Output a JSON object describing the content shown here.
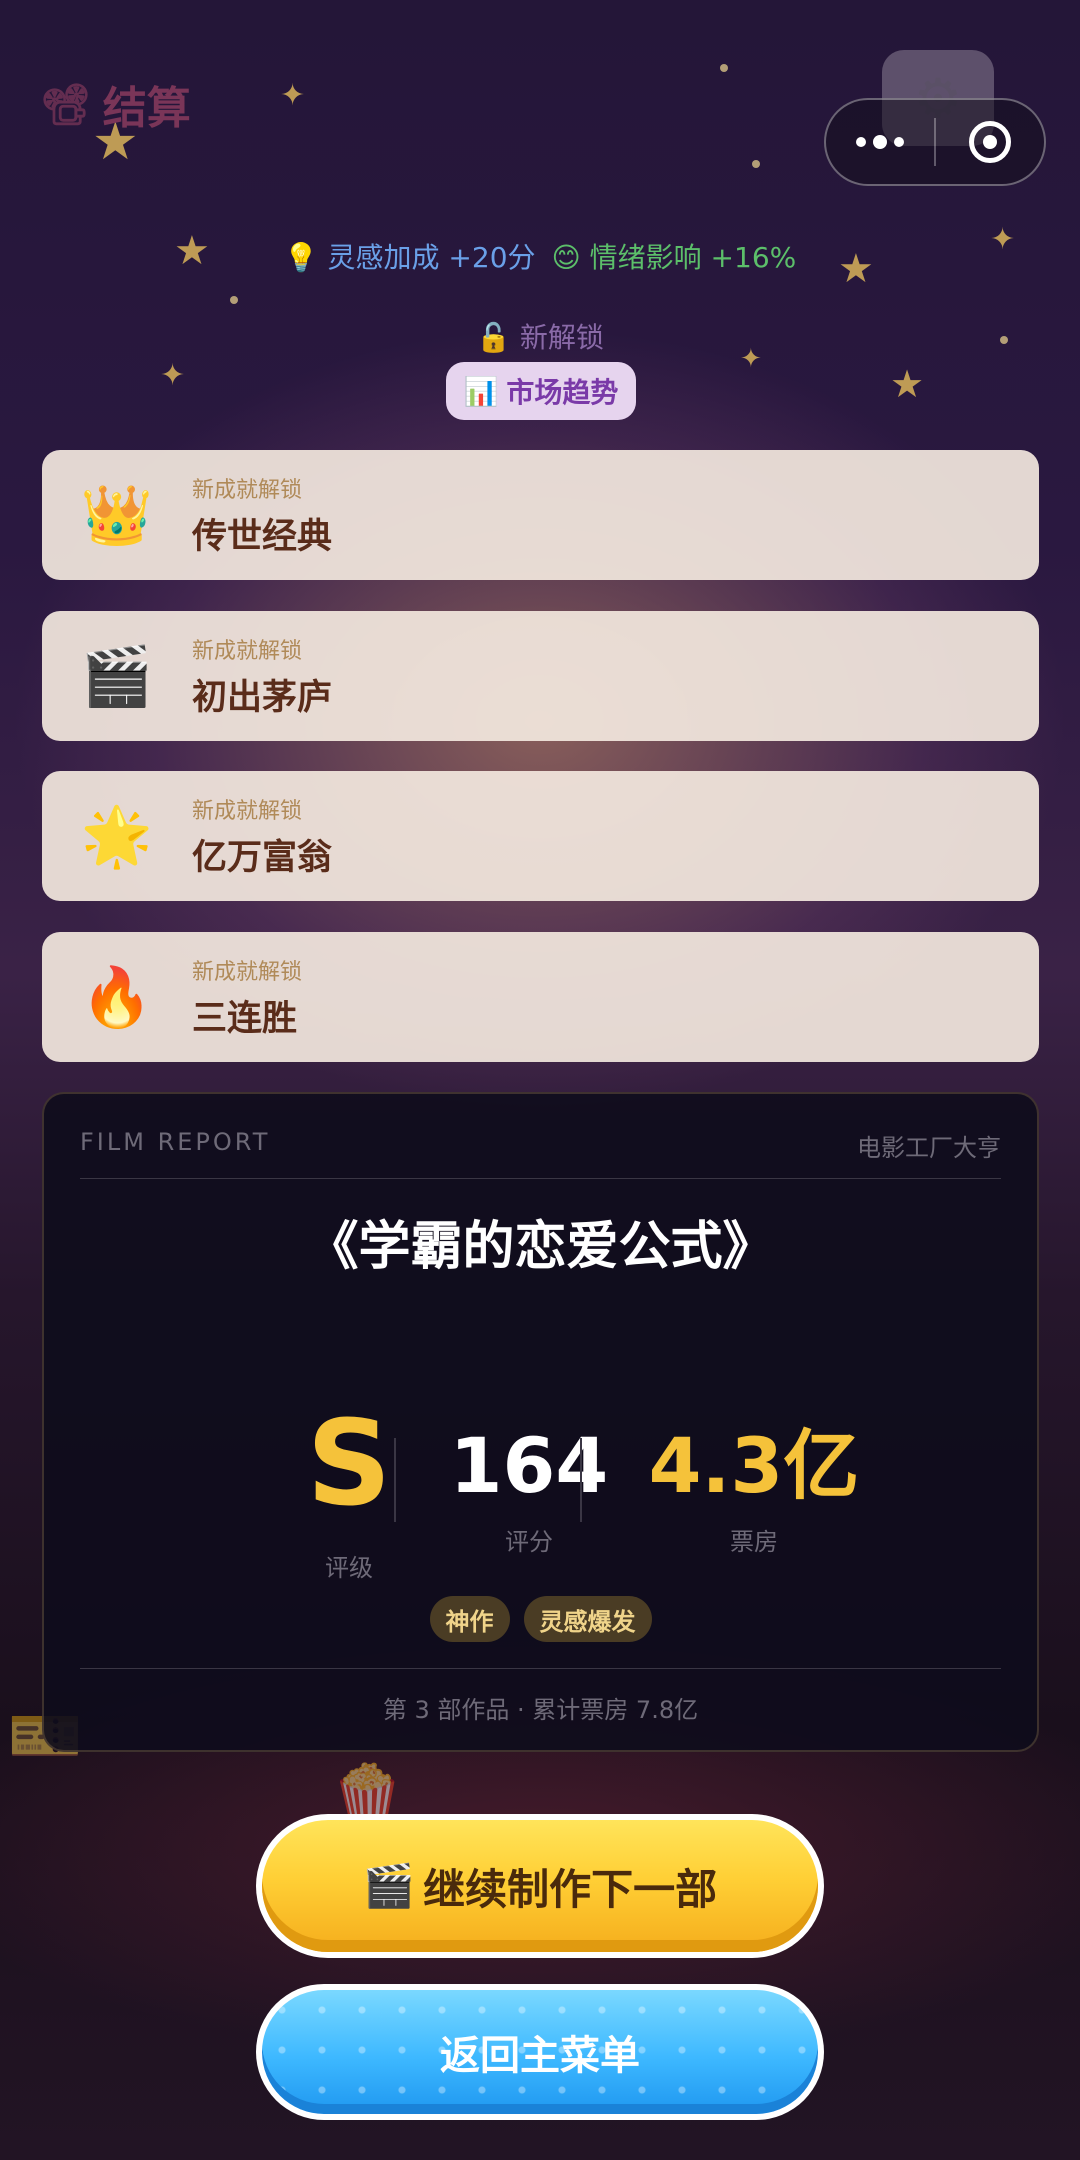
{
  "header": {
    "title": "结算",
    "camera_icon": "movie-camera-icon",
    "settings_icon": "gear-icon"
  },
  "miniprogram_capsule": {
    "more_icon": "more-dots-icon",
    "close_icon": "target-close-icon"
  },
  "bonus": {
    "inspiration": {
      "icon": "💡",
      "text": "灵感加成 +20分"
    },
    "mood": {
      "icon": "😊",
      "text": "情绪影响 +16%"
    }
  },
  "unlock": {
    "label": "🔓 新解锁",
    "chip": {
      "icon": "📊",
      "text": "市场趋势"
    }
  },
  "achievements": [
    {
      "icon": "👑",
      "subtitle": "新成就解锁",
      "name": "传世经典"
    },
    {
      "icon": "🎬",
      "subtitle": "新成就解锁",
      "name": "初出茅庐"
    },
    {
      "icon": "🌟",
      "subtitle": "新成就解锁",
      "name": "亿万富翁"
    },
    {
      "icon": "🔥",
      "subtitle": "新成就解锁",
      "name": "三连胜"
    }
  ],
  "report": {
    "header_left": "FILM REPORT",
    "header_right": "电影工厂大亨",
    "movie_title": "《学霸的恋爱公式》",
    "grade": {
      "value": "S",
      "label": "评级"
    },
    "score": {
      "value": "164",
      "label": "评分"
    },
    "box_office": {
      "value": "4.3亿",
      "label": "票房"
    },
    "tags": [
      "神作",
      "灵感爆发"
    ],
    "footer": "第 3 部作品 · 累计票房 7.8亿"
  },
  "buttons": {
    "next": {
      "icon": "🎬",
      "label": "继续制作下一部"
    },
    "home": {
      "label": "返回主菜单"
    }
  },
  "colors": {
    "accent_gold": "#f5c23a",
    "title_plum": "#7a3558",
    "home_blue": "#3db8ff"
  }
}
